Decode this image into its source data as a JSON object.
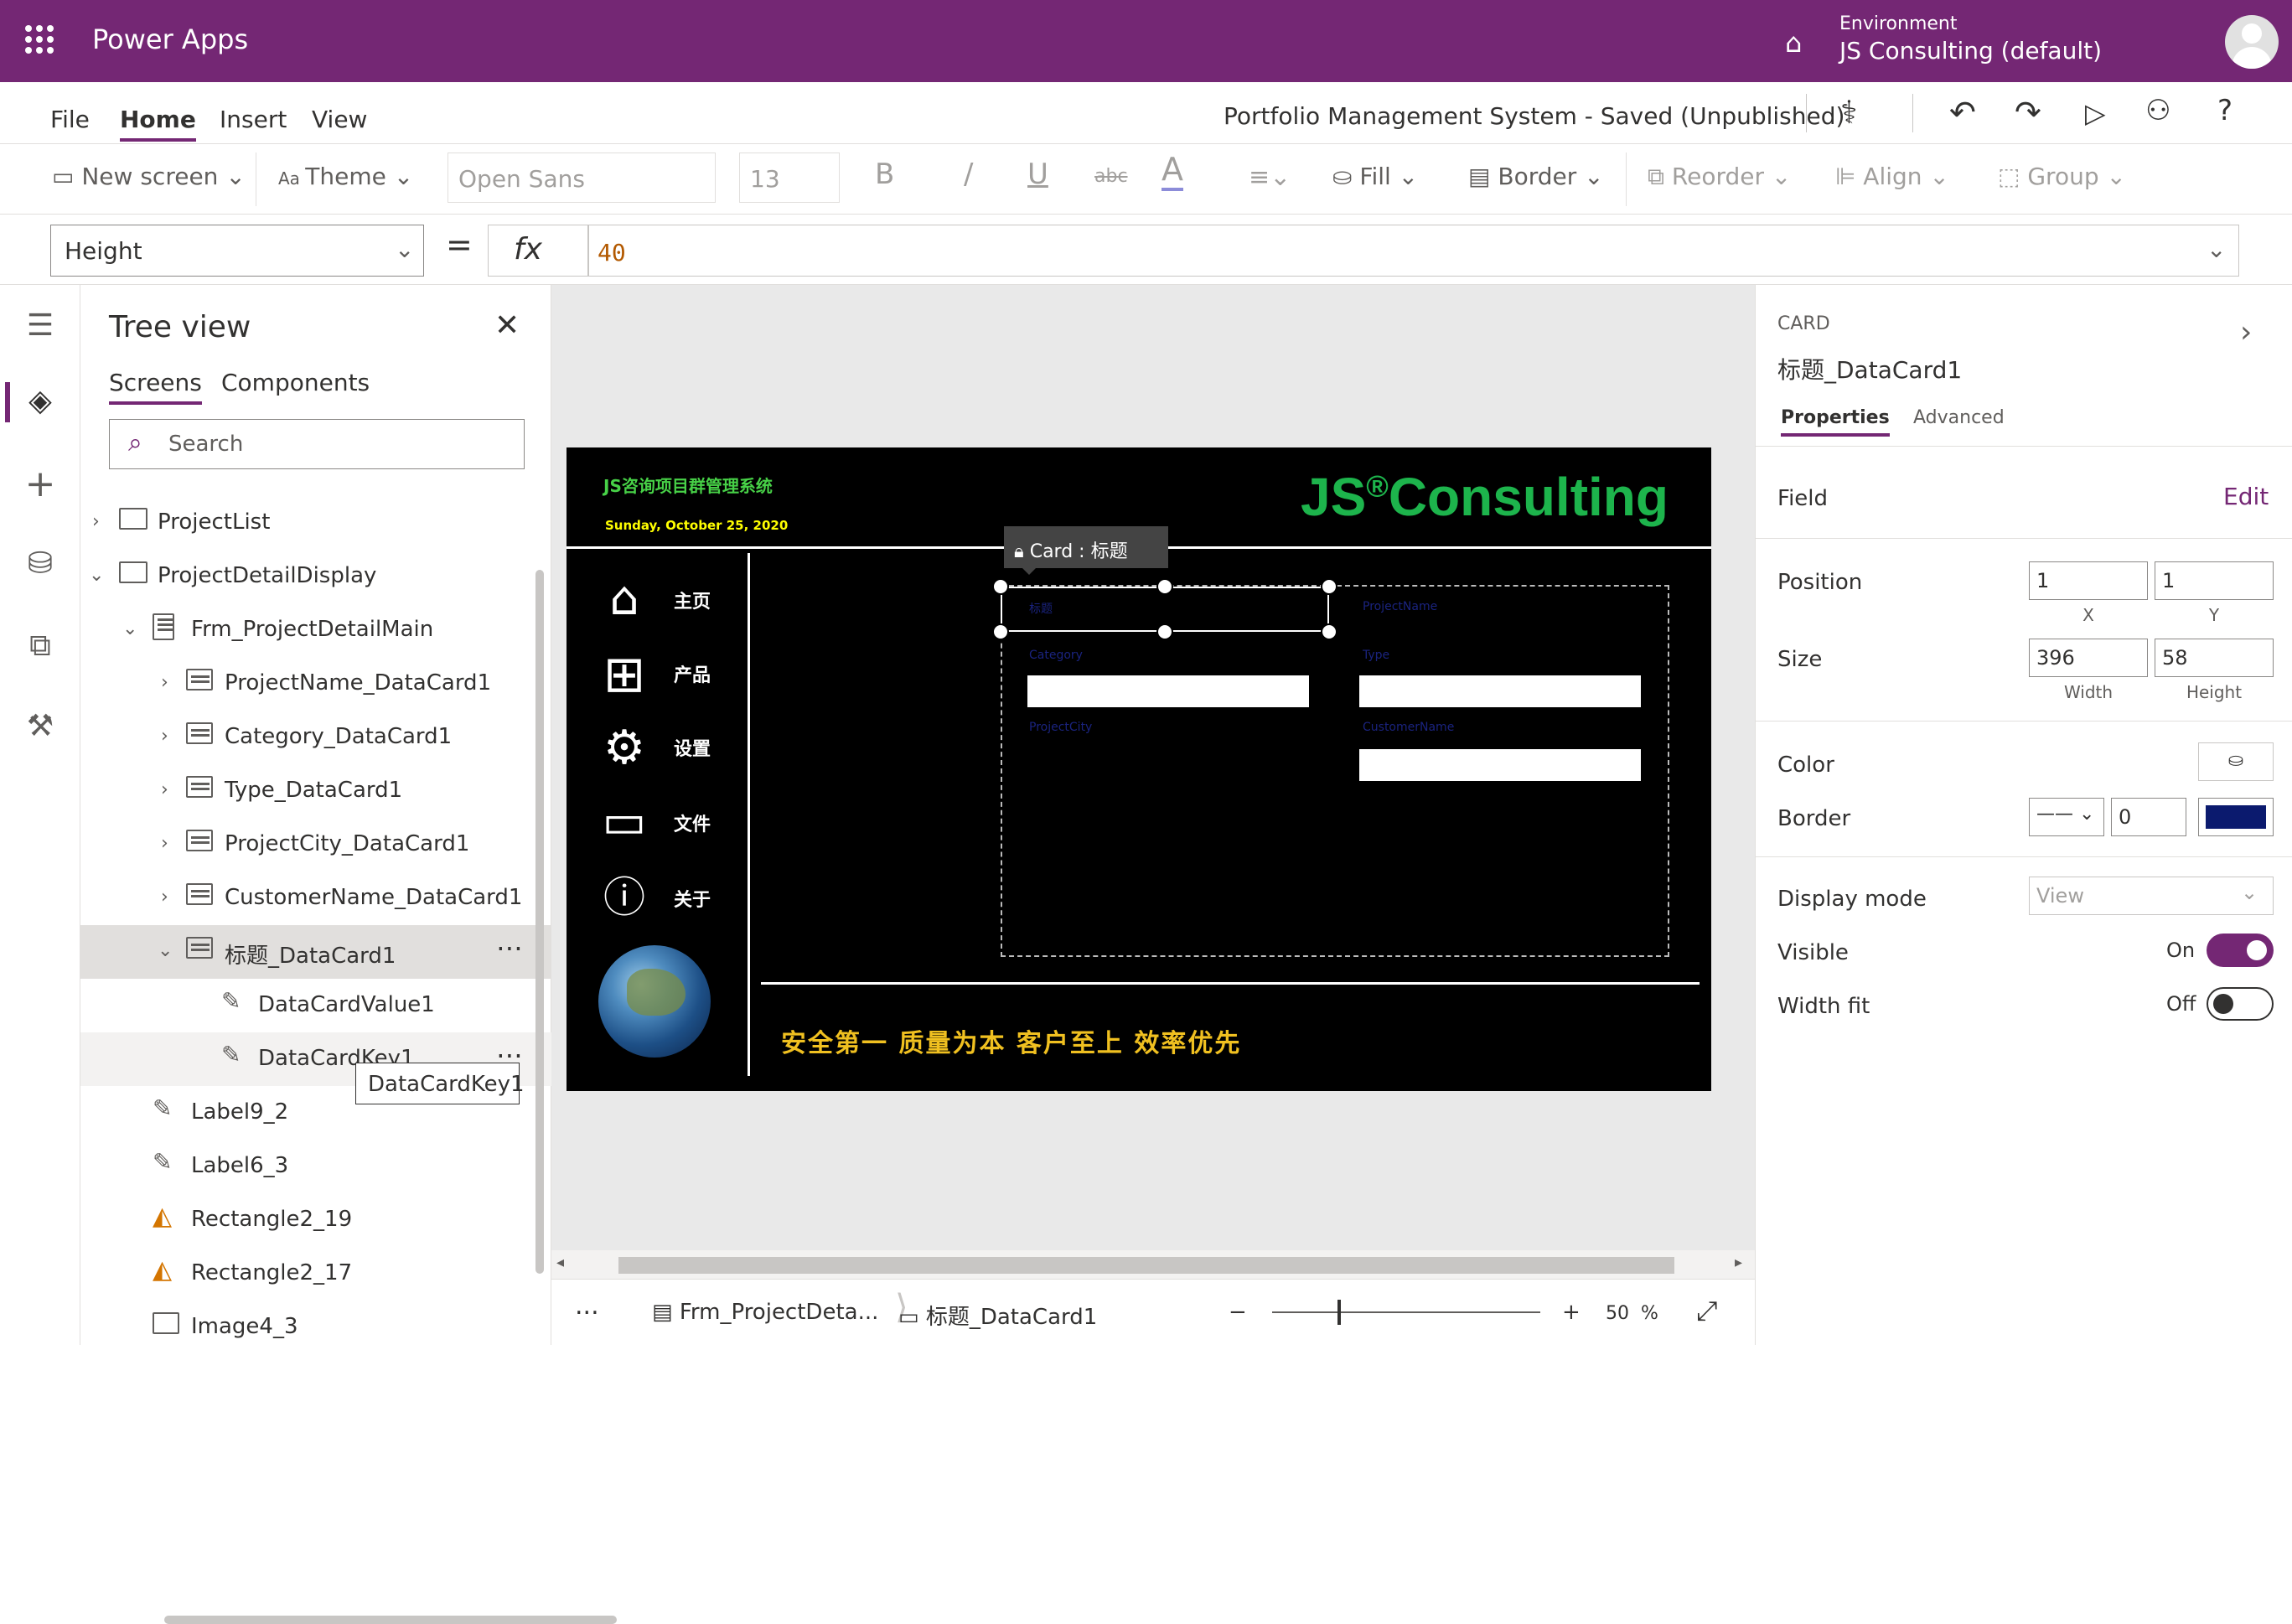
{
  "topbar": {
    "app_name": "Power Apps",
    "environment_label": "Environment",
    "environment_name": "JS Consulting (default)"
  },
  "menubar": {
    "items": [
      "File",
      "Home",
      "Insert",
      "View"
    ],
    "active": "Home",
    "doc_title": "Portfolio Management System - Saved (Unpublished)"
  },
  "ribbon": {
    "new_screen": "New screen",
    "theme": "Theme",
    "font": "Open Sans",
    "font_size": "13",
    "bold": "B",
    "italic": "/",
    "underline": "U",
    "strike": "abc",
    "font_color": "A",
    "fill": "Fill",
    "border": "Border",
    "reorder": "Reorder",
    "align": "Align",
    "group": "Group"
  },
  "formula": {
    "property": "Height",
    "equals": "=",
    "fx": "fx",
    "value": "40"
  },
  "tree": {
    "title": "Tree view",
    "tabs": [
      "Screens",
      "Components"
    ],
    "search_placeholder": "Search",
    "items": [
      {
        "label": "ProjectList",
        "icon": "screen"
      },
      {
        "label": "ProjectDetailDisplay",
        "icon": "screen"
      },
      {
        "label": "Frm_ProjectDetailMain",
        "icon": "form"
      },
      {
        "label": "ProjectName_DataCard1",
        "icon": "card"
      },
      {
        "label": "Category_DataCard1",
        "icon": "card"
      },
      {
        "label": "Type_DataCard1",
        "icon": "card"
      },
      {
        "label": "ProjectCity_DataCard1",
        "icon": "card"
      },
      {
        "label": "CustomerName_DataCard1",
        "icon": "card"
      },
      {
        "label": "标题_DataCard1",
        "icon": "card"
      },
      {
        "label": "DataCardValue1",
        "icon": "edit"
      },
      {
        "label": "DataCardKey1",
        "icon": "edit"
      },
      {
        "label": "Label9_2",
        "icon": "edit"
      },
      {
        "label": "Label6_3",
        "icon": "edit"
      },
      {
        "label": "Rectangle2_19",
        "icon": "rect"
      },
      {
        "label": "Rectangle2_17",
        "icon": "rect"
      },
      {
        "label": "Image4_3",
        "icon": "image"
      }
    ],
    "tooltip": "DataCardKey1"
  },
  "canvas": {
    "header_cn": "JS咨询项目群管理系统",
    "date": "Sunday, October 25, 2020",
    "logo": "JS",
    "logo_reg": "®",
    "logo_rest": "Consulting",
    "nav": [
      "主页",
      "产品",
      "设置",
      "文件",
      "关于"
    ],
    "slogan": "安全第一  质量为本  客户至上  效率优先",
    "card_tag": "Card : 标题",
    "form_labels": [
      "标题",
      "ProjectName",
      "Category",
      "Type",
      "ProjectCity",
      "CustomerName"
    ]
  },
  "statusbar": {
    "more": "...",
    "crumb1": "Frm_ProjectDeta...",
    "crumb2": "标题_DataCard1",
    "zoom_minus": "−",
    "zoom_plus": "+",
    "zoom_value": "50",
    "zoom_unit": "%",
    "zoom_level": 0.5
  },
  "props": {
    "type": "CARD",
    "name": "标题_DataCard1",
    "tabs": [
      "Properties",
      "Advanced"
    ],
    "field_label": "Field",
    "field_edit": "Edit",
    "position_label": "Position",
    "x": "1",
    "y": "1",
    "x_label": "X",
    "y_label": "Y",
    "size_label": "Size",
    "width": "396",
    "height": "58",
    "width_label": "Width",
    "height_label": "Height",
    "color_label": "Color",
    "border_label": "Border",
    "border_width": "0",
    "border_color": "#0b1a6e",
    "display_mode_label": "Display mode",
    "display_mode": "View",
    "visible_label": "Visible",
    "visible_state": "On",
    "widthfit_label": "Width fit",
    "widthfit_state": "Off"
  },
  "colors": {
    "brand": "#742774",
    "logo_green": "#1db44c",
    "slogan_gold": "#f0c020"
  }
}
